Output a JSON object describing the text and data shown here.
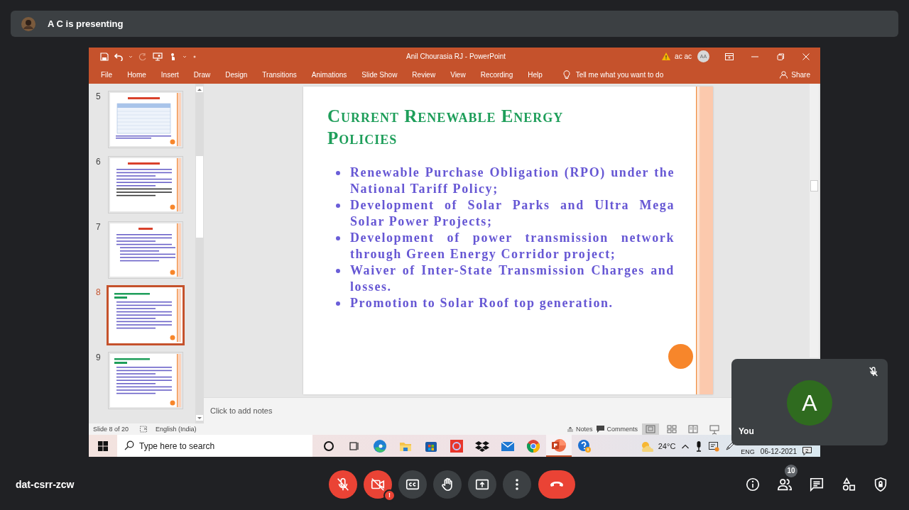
{
  "presenter_banner": {
    "text": "A C is presenting"
  },
  "powerpoint": {
    "title": "Anil Chourasia RJ - PowerPoint",
    "account": {
      "name": "ac ac",
      "initials": "AA"
    },
    "ribbon_tabs": [
      "File",
      "Home",
      "Insert",
      "Draw",
      "Design",
      "Transitions",
      "Animations",
      "Slide Show",
      "Review",
      "View",
      "Recording",
      "Help"
    ],
    "tell_me": "Tell me what you want to do",
    "share": "Share",
    "thumbnails": [
      {
        "number": "5",
        "selected": false
      },
      {
        "number": "6",
        "selected": false
      },
      {
        "number": "7",
        "selected": false
      },
      {
        "number": "8",
        "selected": true
      },
      {
        "number": "9",
        "selected": false
      }
    ],
    "slide": {
      "title": "Current Renewable Energy Policies",
      "bullets": [
        "Renewable Purchase Obligation (RPO) under the National Tariff Policy;",
        "Development of Solar Parks and Ultra Mega Solar Power Projects;",
        "Development of power transmission network through Green Energy Corridor project;",
        "Waiver of Inter-State Transmission Charges and losses.",
        "Promotion to Solar Roof top generation."
      ]
    },
    "notes": {
      "placeholder": "Click to add notes"
    },
    "status_bar": {
      "slide_position": "Slide 8 of 20",
      "language": "English (India)",
      "notes": "Notes",
      "comments": "Comments",
      "views": [
        {
          "kind": "normal",
          "selected": true
        },
        {
          "kind": "sorter",
          "selected": false
        },
        {
          "kind": "reading",
          "selected": false
        },
        {
          "kind": "slideshow",
          "selected": false
        }
      ]
    }
  },
  "taskbar": {
    "search": {
      "placeholder": "Type here to search"
    },
    "apps": [
      {
        "kind": "cortana",
        "active": false
      },
      {
        "kind": "taskview",
        "active": false
      },
      {
        "kind": "edge",
        "active": false
      },
      {
        "kind": "explorer",
        "active": false
      },
      {
        "kind": "store",
        "active": false
      },
      {
        "kind": "opera",
        "active": false
      },
      {
        "kind": "dropbox",
        "active": false
      },
      {
        "kind": "mail",
        "active": false
      },
      {
        "kind": "chrome",
        "active": false
      },
      {
        "kind": "powerpoint",
        "active": true
      },
      {
        "kind": "help",
        "active": false
      }
    ],
    "weather": "24°C",
    "language": "ENG",
    "date": "06-12-2021",
    "notifications": "2"
  },
  "self_view": {
    "initial": "A",
    "label": "You",
    "muted": true
  },
  "meeting": {
    "code": "dat-csrr-zcw",
    "controls": [
      {
        "kind": "mic",
        "on": false
      },
      {
        "kind": "camera",
        "on": false,
        "alert": "!"
      },
      {
        "kind": "captions",
        "on": false
      },
      {
        "kind": "hand",
        "on": false
      },
      {
        "kind": "present",
        "on": false
      },
      {
        "kind": "more"
      },
      {
        "kind": "leave"
      }
    ],
    "side_buttons": [
      {
        "kind": "info"
      },
      {
        "kind": "people",
        "badge": "10"
      },
      {
        "kind": "chat"
      },
      {
        "kind": "activities"
      },
      {
        "kind": "safety"
      }
    ]
  }
}
